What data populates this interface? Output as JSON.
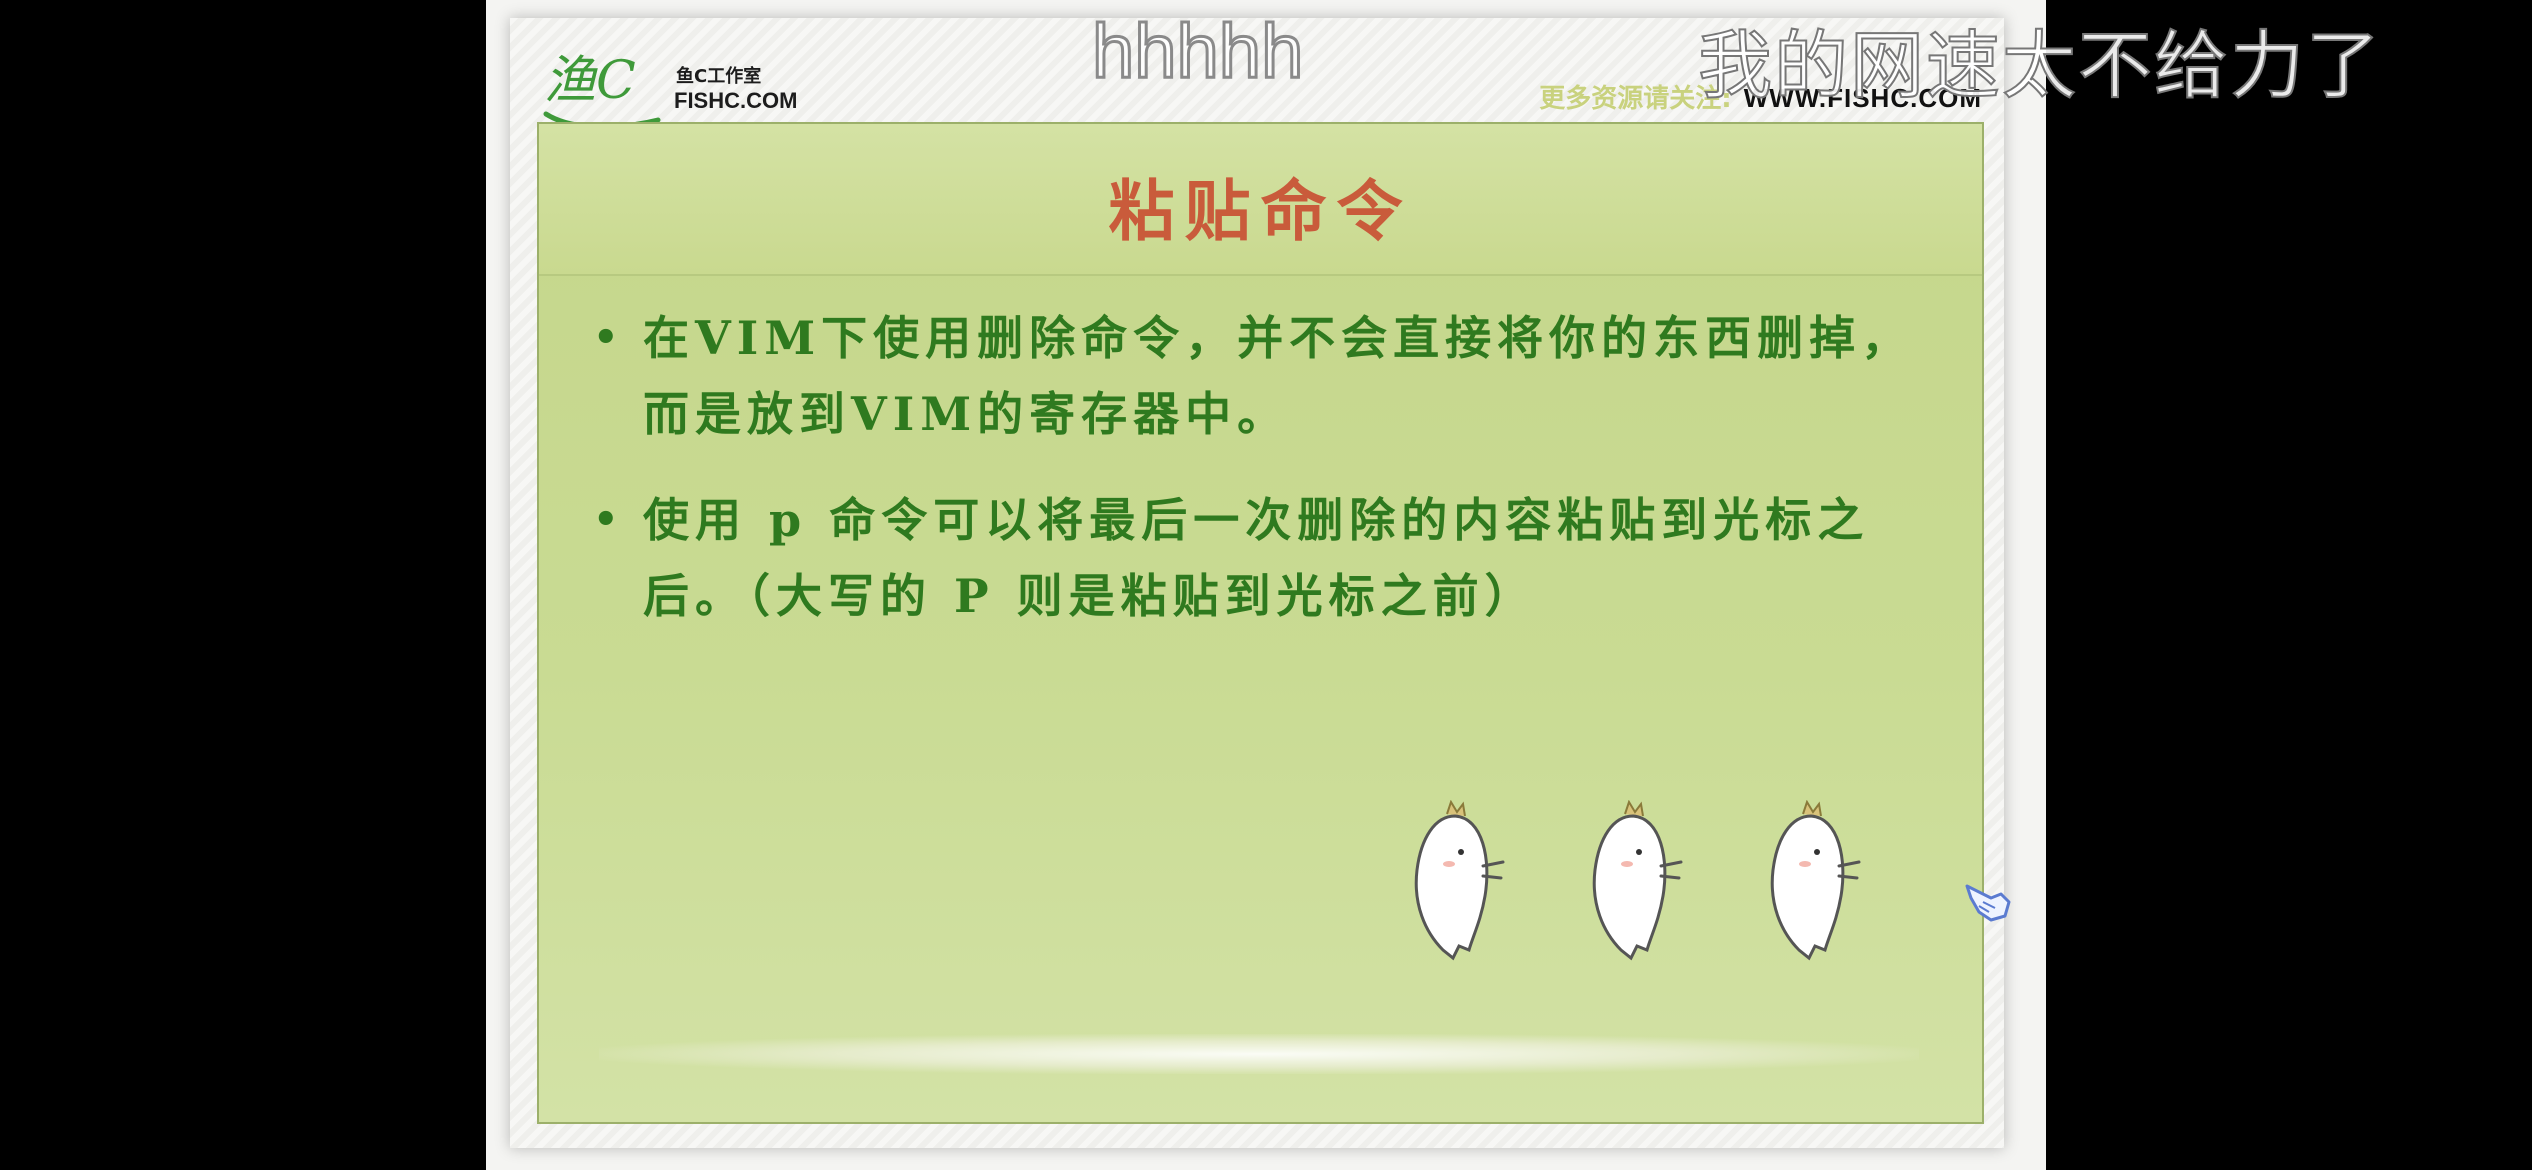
{
  "logo": {
    "mark_text": "渔C",
    "studio_cn": "鱼C工作室",
    "site_small": "FISHC.COM"
  },
  "header": {
    "more_resources": "更多资源请关注:",
    "site_url": "WWW.FISHC.COM"
  },
  "slide": {
    "title": "粘贴命令",
    "bullets": [
      "在VIM下使用删除命令，并不会直接将你的东西删掉，而是放到VIM的寄存器中。",
      "使用 p 命令可以将最后一次删除的内容粘贴到光标之后。（大写的 P 则是粘贴到光标之前）"
    ],
    "bullet_glyph": "•",
    "mascot_count": 3
  },
  "overlays": {
    "hhhhh": "hhhhh",
    "network_comment": "我的网速太不给力了"
  },
  "colors": {
    "title": "#c95b3b",
    "bullet_text": "#2f7a1f",
    "panel_green": "#c8d98f",
    "more_resources": "#c9d27e"
  }
}
